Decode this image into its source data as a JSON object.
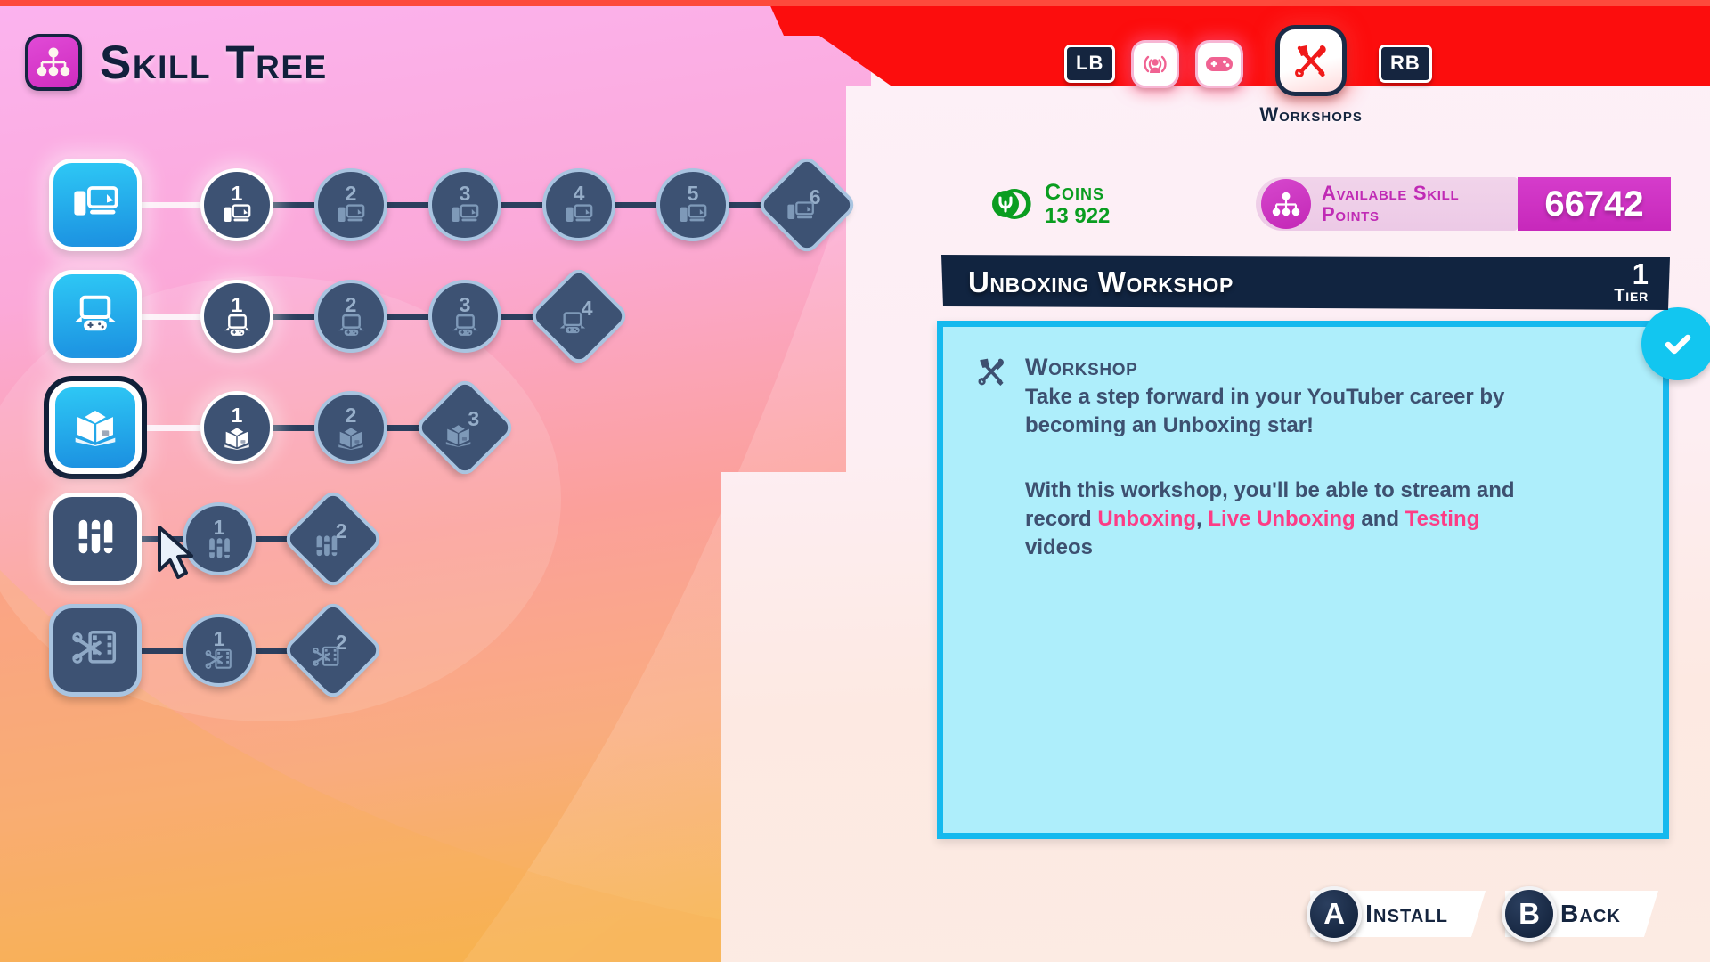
{
  "header": {
    "title": "Skill Tree",
    "title_icon": "skill-tree-icon",
    "brand_red": "#fc0d0d",
    "navy": "#112440"
  },
  "tabs": {
    "left_shoulder": "LB",
    "right_shoulder": "RB",
    "items": [
      {
        "icon": "broadcast-person-icon",
        "label": "",
        "active": false
      },
      {
        "icon": "gamepad-icon",
        "label": "",
        "active": false
      },
      {
        "icon": "hammer-wrench-icon",
        "label": "Workshops",
        "active": true
      }
    ]
  },
  "resources": {
    "coins": {
      "icon": "coin-stack-icon",
      "label": "Coins",
      "value": "13 922",
      "color": "#0a9d20"
    },
    "skill_points": {
      "icon": "skill-tree-icon",
      "label": "Available Skill Points",
      "value": "66742",
      "color": "#c02bb5"
    }
  },
  "workshop_header": {
    "name": "Unboxing Workshop",
    "tier_value": "1",
    "tier_label": "Tier"
  },
  "info": {
    "icon": "hammer-wrench-icon",
    "subtitle": "Workshop",
    "paragraph1": "Take a step forward in your YouTuber career by becoming an Unboxing star!",
    "paragraph2_pre": "With this workshop, you'll be able to stream and record ",
    "highlight1": "Unboxing",
    "sep1": ", ",
    "highlight2": "Live Unboxing",
    "sep2": " and ",
    "highlight3": "Testing",
    "paragraph2_post": " videos",
    "installed_badge": "check-icon",
    "border_color": "#15b9ee",
    "fill_color": "#aeeefb",
    "highlight_color": "#fd3c86"
  },
  "tree": {
    "rows": [
      {
        "name": "pc-setup",
        "root_icon": "pc-monitor-icon",
        "root_state": "unlocked",
        "nodes": [
          {
            "num": "1",
            "state": "unlocked",
            "shape": "circle"
          },
          {
            "num": "2",
            "state": "locked",
            "shape": "circle"
          },
          {
            "num": "3",
            "state": "locked",
            "shape": "circle"
          },
          {
            "num": "4",
            "state": "locked",
            "shape": "circle"
          },
          {
            "num": "5",
            "state": "locked",
            "shape": "circle"
          },
          {
            "num": "6",
            "state": "locked",
            "shape": "diamond"
          }
        ]
      },
      {
        "name": "console-gaming",
        "root_icon": "console-gamepad-icon",
        "root_state": "unlocked",
        "nodes": [
          {
            "num": "1",
            "state": "unlocked",
            "shape": "circle"
          },
          {
            "num": "2",
            "state": "locked",
            "shape": "circle"
          },
          {
            "num": "3",
            "state": "locked",
            "shape": "circle"
          },
          {
            "num": "4",
            "state": "locked",
            "shape": "diamond"
          }
        ]
      },
      {
        "name": "unboxing",
        "root_icon": "open-box-icon",
        "root_state": "selected",
        "nodes": [
          {
            "num": "1",
            "state": "unlocked",
            "shape": "circle"
          },
          {
            "num": "2",
            "state": "locked",
            "shape": "circle"
          },
          {
            "num": "3",
            "state": "locked",
            "shape": "diamond"
          }
        ]
      },
      {
        "name": "audio-mixing",
        "root_icon": "mixer-sliders-icon",
        "root_state": "unlocked-dark",
        "nodes": [
          {
            "num": "1",
            "state": "locked",
            "shape": "circle"
          },
          {
            "num": "2",
            "state": "locked",
            "shape": "diamond"
          }
        ]
      },
      {
        "name": "video-editing",
        "root_icon": "film-cut-icon",
        "root_state": "locked",
        "nodes": [
          {
            "num": "1",
            "state": "locked",
            "shape": "circle"
          },
          {
            "num": "2",
            "state": "locked",
            "shape": "diamond"
          }
        ]
      }
    ]
  },
  "bottom_buttons": [
    {
      "glyph": "A",
      "label": "Install"
    },
    {
      "glyph": "B",
      "label": "Back"
    }
  ]
}
